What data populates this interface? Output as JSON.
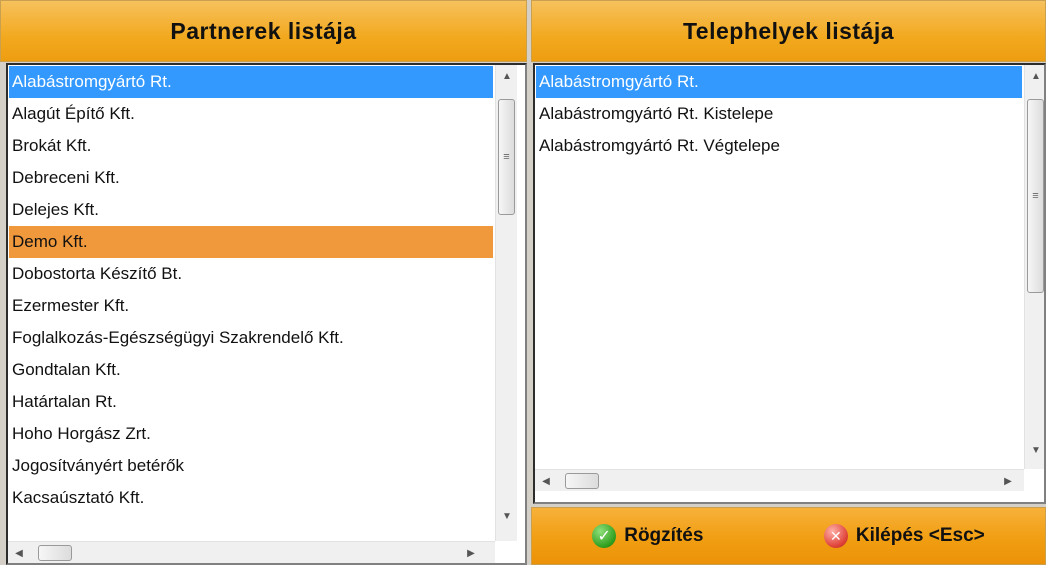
{
  "left": {
    "title": "Partnerek listája",
    "items": [
      "Alabástromgyártó Rt.",
      "Alagút Építő Kft.",
      "Brokát Kft.",
      "Debreceni Kft.",
      "Delejes Kft.",
      "Demo Kft.",
      "Dobostorta Készítő Bt.",
      "Ezermester Kft.",
      "Foglalkozás-Egészségügyi Szakrendelő Kft.",
      "Gondtalan Kft.",
      "Határtalan Rt.",
      "Hoho Horgász Zrt.",
      "Jogosítványért betérők",
      "Kacsaúsztató Kft."
    ],
    "selected_index": 0,
    "highlighted_index": 5
  },
  "right": {
    "title": "Telephelyek listája",
    "items": [
      "Alabástromgyártó Rt.",
      "Alabástromgyártó Rt. Kistelepe",
      "Alabástromgyártó Rt. Végtelepe"
    ],
    "selected_index": 0
  },
  "footer": {
    "save_label": "Rögzítés",
    "exit_label": "Kilépés <Esc>",
    "save_icon": "check-circle-icon",
    "exit_icon": "cross-circle-icon"
  },
  "colors": {
    "header_orange": "#f2a91f",
    "selection_blue": "#3399ff",
    "highlight_orange": "#f0983c"
  }
}
